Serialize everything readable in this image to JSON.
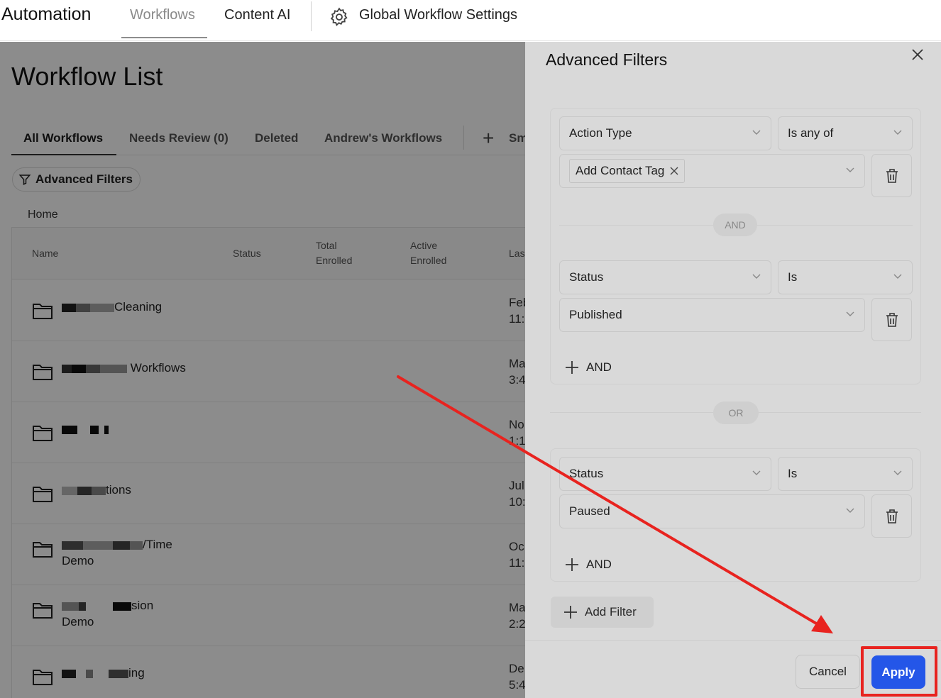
{
  "topbar": {
    "app_title": "Automation",
    "tabs": [
      "Workflows",
      "Content AI"
    ],
    "global_settings": "Global Workflow Settings"
  },
  "main": {
    "page_title": "Workflow List",
    "tabs": [
      "All Workflows",
      "Needs Review (0)",
      "Deleted",
      "Andrew's Workflows",
      "Sm"
    ],
    "advanced_filters_label": "Advanced Filters",
    "breadcrumb": "Home",
    "columns": {
      "name": "Name",
      "status": "Status",
      "total_1": "Total",
      "total_2": "Enrolled",
      "active_1": "Active",
      "active_2": "Enrolled",
      "last": "Las"
    },
    "rows": [
      {
        "name": "Cleaning",
        "name2": "",
        "date1": "Feb",
        "date2": "11:"
      },
      {
        "name": "Workflows",
        "name2": "",
        "date1": "Ma",
        "date2": "3:4"
      },
      {
        "name": "",
        "name2": "",
        "date1": "No",
        "date2": "1:1"
      },
      {
        "name": "tions",
        "name2": "",
        "date1": "Jul",
        "date2": "10:"
      },
      {
        "name": "/Time",
        "name2": "Demo",
        "date1": "Oc",
        "date2": "11:"
      },
      {
        "name": "sion",
        "name2": "Demo",
        "date1": "Ma",
        "date2": "2:2"
      },
      {
        "name": "ing",
        "name2": "",
        "date1": "De",
        "date2": "5:4"
      }
    ]
  },
  "drawer": {
    "title": "Advanced Filters",
    "group1": {
      "field": "Action Type",
      "operator": "Is any of",
      "tag": "Add Contact Tag"
    },
    "and_label": "AND",
    "group1b": {
      "field": "Status",
      "operator": "Is",
      "value": "Published"
    },
    "add_and": "AND",
    "or_label": "OR",
    "group2": {
      "field": "Status",
      "operator": "Is",
      "value": "Paused"
    },
    "add_and2": "AND",
    "add_filter": "Add Filter",
    "cancel": "Cancel",
    "apply": "Apply"
  },
  "colors": {
    "apply_blue": "#2456e8",
    "annotation_red": "#e8231f"
  }
}
